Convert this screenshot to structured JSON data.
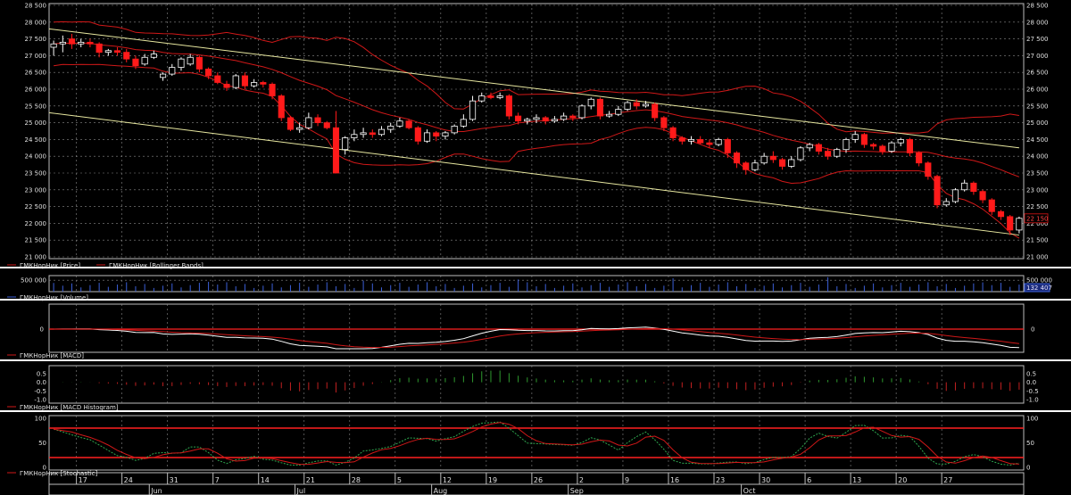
{
  "chart_data": [
    {
      "type": "candlestick",
      "panel": "price",
      "ylim": [
        21000,
        28500
      ],
      "ticks": [
        "21 000",
        "21 500",
        "22 000",
        "22 500",
        "23 000",
        "23 500",
        "24 000",
        "24 500",
        "25 000",
        "25 500",
        "26 000",
        "26 500",
        "27 000",
        "27 500",
        "28 000",
        "28 500"
      ],
      "tick_values": [
        21000,
        21500,
        22000,
        22500,
        23000,
        23500,
        24000,
        24500,
        25000,
        25500,
        26000,
        26500,
        27000,
        27500,
        28000,
        28500
      ],
      "last_price": "22 150",
      "last_value": 22150,
      "legend": [
        "ГМКНорНик [Price]",
        "ГМКНорНик [Bollinger Bands]"
      ],
      "candles": [
        {
          "o": 27250,
          "c": 27350,
          "h": 27450,
          "l": 27000
        },
        {
          "o": 27350,
          "c": 27400,
          "h": 27600,
          "l": 27100
        },
        {
          "o": 27500,
          "c": 27350,
          "h": 27650,
          "l": 27200
        },
        {
          "o": 27350,
          "c": 27400,
          "h": 27500,
          "l": 27250
        },
        {
          "o": 27400,
          "c": 27350,
          "h": 27500,
          "l": 27250
        },
        {
          "o": 27350,
          "c": 27100,
          "h": 27400,
          "l": 26950
        },
        {
          "o": 27100,
          "c": 27150,
          "h": 27200,
          "l": 27000
        },
        {
          "o": 27150,
          "c": 27100,
          "h": 27250,
          "l": 27000
        },
        {
          "o": 27100,
          "c": 26900,
          "h": 27200,
          "l": 26800
        },
        {
          "o": 26900,
          "c": 26700,
          "h": 27000,
          "l": 26600
        },
        {
          "o": 26750,
          "c": 26950,
          "h": 27050,
          "l": 26700
        },
        {
          "o": 26950,
          "c": 27050,
          "h": 27150,
          "l": 26900
        },
        {
          "o": 26350,
          "c": 26450,
          "h": 26500,
          "l": 26250
        },
        {
          "o": 26450,
          "c": 26650,
          "h": 26750,
          "l": 26400
        },
        {
          "o": 26650,
          "c": 26900,
          "h": 26950,
          "l": 26550
        },
        {
          "o": 26750,
          "c": 26950,
          "h": 27050,
          "l": 26700
        },
        {
          "o": 26950,
          "c": 26600,
          "h": 27000,
          "l": 26500
        },
        {
          "o": 26600,
          "c": 26400,
          "h": 26650,
          "l": 26300
        },
        {
          "o": 26400,
          "c": 26200,
          "h": 26500,
          "l": 26150
        },
        {
          "o": 26150,
          "c": 26050,
          "h": 26250,
          "l": 25950
        },
        {
          "o": 26050,
          "c": 26400,
          "h": 26450,
          "l": 26000
        },
        {
          "o": 26400,
          "c": 26100,
          "h": 26500,
          "l": 26000
        },
        {
          "o": 26100,
          "c": 26200,
          "h": 26300,
          "l": 26050
        },
        {
          "o": 26200,
          "c": 26150,
          "h": 26250,
          "l": 26050
        },
        {
          "o": 26150,
          "c": 25800,
          "h": 26200,
          "l": 25700
        },
        {
          "o": 25800,
          "c": 25150,
          "h": 25850,
          "l": 25050
        },
        {
          "o": 25150,
          "c": 24800,
          "h": 25200,
          "l": 24750
        },
        {
          "o": 24800,
          "c": 24850,
          "h": 25000,
          "l": 24700
        },
        {
          "o": 24850,
          "c": 25150,
          "h": 25300,
          "l": 24800
        },
        {
          "o": 25150,
          "c": 25000,
          "h": 25250,
          "l": 24900
        },
        {
          "o": 25000,
          "c": 24850,
          "h": 25050,
          "l": 24800
        },
        {
          "o": 24850,
          "c": 23500,
          "h": 25350,
          "l": 23700
        },
        {
          "o": 24200,
          "c": 24550,
          "h": 24600,
          "l": 24050
        },
        {
          "o": 24550,
          "c": 24650,
          "h": 24800,
          "l": 24450
        },
        {
          "o": 24650,
          "c": 24700,
          "h": 24850,
          "l": 24550
        },
        {
          "o": 24700,
          "c": 24650,
          "h": 24800,
          "l": 24550
        },
        {
          "o": 24650,
          "c": 24800,
          "h": 24900,
          "l": 24600
        },
        {
          "o": 24800,
          "c": 24900,
          "h": 25000,
          "l": 24700
        },
        {
          "o": 24900,
          "c": 25050,
          "h": 25150,
          "l": 24850
        },
        {
          "o": 25050,
          "c": 24850,
          "h": 25100,
          "l": 24800
        },
        {
          "o": 24850,
          "c": 24450,
          "h": 24900,
          "l": 24350
        },
        {
          "o": 24450,
          "c": 24700,
          "h": 24800,
          "l": 24400
        },
        {
          "o": 24700,
          "c": 24600,
          "h": 24750,
          "l": 24450
        },
        {
          "o": 24600,
          "c": 24700,
          "h": 24750,
          "l": 24500
        },
        {
          "o": 24700,
          "c": 24900,
          "h": 24950,
          "l": 24650
        },
        {
          "o": 24900,
          "c": 25100,
          "h": 25250,
          "l": 24850
        },
        {
          "o": 25100,
          "c": 25650,
          "h": 25800,
          "l": 25050
        },
        {
          "o": 25650,
          "c": 25800,
          "h": 25900,
          "l": 25600
        },
        {
          "o": 25800,
          "c": 25750,
          "h": 25900,
          "l": 25700
        },
        {
          "o": 25750,
          "c": 25800,
          "h": 25900,
          "l": 25700
        },
        {
          "o": 25800,
          "c": 25200,
          "h": 25850,
          "l": 25100
        },
        {
          "o": 25200,
          "c": 25050,
          "h": 25300,
          "l": 24950
        },
        {
          "o": 25050,
          "c": 25100,
          "h": 25150,
          "l": 24950
        },
        {
          "o": 25100,
          "c": 25150,
          "h": 25250,
          "l": 25000
        },
        {
          "o": 25150,
          "c": 25050,
          "h": 25200,
          "l": 24950
        },
        {
          "o": 25050,
          "c": 25100,
          "h": 25200,
          "l": 25000
        },
        {
          "o": 25100,
          "c": 25200,
          "h": 25300,
          "l": 25050
        },
        {
          "o": 25200,
          "c": 25150,
          "h": 25250,
          "l": 25050
        },
        {
          "o": 25150,
          "c": 25500,
          "h": 25550,
          "l": 25100
        },
        {
          "o": 25500,
          "c": 25700,
          "h": 25750,
          "l": 25400
        },
        {
          "o": 25700,
          "c": 25200,
          "h": 25750,
          "l": 25100
        },
        {
          "o": 25200,
          "c": 25250,
          "h": 25350,
          "l": 25150
        },
        {
          "o": 25250,
          "c": 25400,
          "h": 25500,
          "l": 25200
        },
        {
          "o": 25400,
          "c": 25600,
          "h": 25650,
          "l": 25350
        },
        {
          "o": 25600,
          "c": 25500,
          "h": 25700,
          "l": 25400
        },
        {
          "o": 25500,
          "c": 25550,
          "h": 25650,
          "l": 25450
        },
        {
          "o": 25550,
          "c": 25150,
          "h": 25600,
          "l": 25050
        },
        {
          "o": 25150,
          "c": 24850,
          "h": 25200,
          "l": 24750
        },
        {
          "o": 24850,
          "c": 24550,
          "h": 24900,
          "l": 24450
        },
        {
          "o": 24550,
          "c": 24450,
          "h": 24600,
          "l": 24350
        },
        {
          "o": 24450,
          "c": 24500,
          "h": 24600,
          "l": 24350
        },
        {
          "o": 24500,
          "c": 24400,
          "h": 24600,
          "l": 24350
        },
        {
          "o": 24400,
          "c": 24350,
          "h": 24500,
          "l": 24250
        },
        {
          "o": 24350,
          "c": 24500,
          "h": 24550,
          "l": 24300
        },
        {
          "o": 24500,
          "c": 24100,
          "h": 24550,
          "l": 23950
        },
        {
          "o": 24100,
          "c": 23800,
          "h": 24150,
          "l": 23650
        },
        {
          "o": 23800,
          "c": 23600,
          "h": 23850,
          "l": 23450
        },
        {
          "o": 23600,
          "c": 23800,
          "h": 23900,
          "l": 23550
        },
        {
          "o": 23800,
          "c": 24000,
          "h": 24100,
          "l": 23750
        },
        {
          "o": 24000,
          "c": 23900,
          "h": 24150,
          "l": 23800
        },
        {
          "o": 23900,
          "c": 23700,
          "h": 23950,
          "l": 23600
        },
        {
          "o": 23700,
          "c": 23900,
          "h": 24000,
          "l": 23650
        },
        {
          "o": 23900,
          "c": 24250,
          "h": 24300,
          "l": 23850
        },
        {
          "o": 24250,
          "c": 24350,
          "h": 24400,
          "l": 24150
        },
        {
          "o": 24350,
          "c": 24150,
          "h": 24400,
          "l": 24050
        },
        {
          "o": 24150,
          "c": 24000,
          "h": 24250,
          "l": 23900
        },
        {
          "o": 24000,
          "c": 24200,
          "h": 24250,
          "l": 23950
        },
        {
          "o": 24200,
          "c": 24500,
          "h": 24550,
          "l": 24100
        },
        {
          "o": 24500,
          "c": 24650,
          "h": 24750,
          "l": 24400
        },
        {
          "o": 24650,
          "c": 24350,
          "h": 24700,
          "l": 24250
        },
        {
          "o": 24350,
          "c": 24300,
          "h": 24400,
          "l": 24200
        },
        {
          "o": 24300,
          "c": 24150,
          "h": 24350,
          "l": 24050
        },
        {
          "o": 24150,
          "c": 24400,
          "h": 24450,
          "l": 24100
        },
        {
          "o": 24400,
          "c": 24500,
          "h": 24550,
          "l": 24300
        },
        {
          "o": 24500,
          "c": 24100,
          "h": 24550,
          "l": 24000
        },
        {
          "o": 24100,
          "c": 23800,
          "h": 24150,
          "l": 23700
        },
        {
          "o": 23800,
          "c": 23400,
          "h": 23850,
          "l": 23300
        },
        {
          "o": 23400,
          "c": 22550,
          "h": 23450,
          "l": 22450
        },
        {
          "o": 22550,
          "c": 22650,
          "h": 22750,
          "l": 22500
        },
        {
          "o": 22650,
          "c": 23000,
          "h": 23050,
          "l": 22600
        },
        {
          "o": 23000,
          "c": 23200,
          "h": 23300,
          "l": 22950
        },
        {
          "o": 23200,
          "c": 22950,
          "h": 23250,
          "l": 22850
        },
        {
          "o": 22950,
          "c": 22700,
          "h": 23000,
          "l": 22600
        },
        {
          "o": 22700,
          "c": 22350,
          "h": 22750,
          "l": 22250
        },
        {
          "o": 22350,
          "c": 22200,
          "h": 22400,
          "l": 22100
        },
        {
          "o": 22200,
          "c": 21800,
          "h": 22250,
          "l": 21650
        },
        {
          "o": 21800,
          "c": 22150,
          "h": 22200,
          "l": 21700
        }
      ],
      "trendlines": [
        {
          "x1": 0,
          "y1": 27800,
          "x2": 106,
          "y2": 24250
        },
        {
          "x1": 0,
          "y1": 25300,
          "x2": 106,
          "y2": 21650
        }
      ]
    },
    {
      "type": "bar",
      "panel": "volume",
      "tick_label": "500 000",
      "last_value_label": "132 407",
      "legend": [
        "ГМКНорНик [Volume]"
      ],
      "ylim": [
        0,
        700000
      ],
      "tick_values": [
        500000
      ]
    },
    {
      "type": "line",
      "panel": "macd",
      "tick_label": "0",
      "legend": [
        "ГМКНорНик [MACD]"
      ]
    },
    {
      "type": "bar",
      "panel": "macd_histogram",
      "ticks": [
        "0.5",
        "0.0",
        "-0.5",
        "-1.0"
      ],
      "tick_values": [
        0.5,
        0.0,
        -0.5,
        -1.0
      ],
      "legend": [
        "ГМКНорНик [MACD Histogram]"
      ]
    },
    {
      "type": "line",
      "panel": "stochastic",
      "ticks": [
        "100",
        "50",
        "0"
      ],
      "tick_values": [
        100,
        50,
        0
      ],
      "ylim": [
        0,
        100
      ],
      "levels": [
        80,
        20
      ],
      "legend": [
        "ГМКНорНик [Stochastic]"
      ]
    }
  ],
  "time_axis": {
    "day_labels": [
      "17",
      "24",
      "31",
      "7",
      "14",
      "21",
      "28",
      "5",
      "12",
      "19",
      "26",
      "2",
      "9",
      "16",
      "23",
      "30",
      "6",
      "13",
      "20",
      "27"
    ],
    "month_labels": [
      "Jun",
      "Jul",
      "Aug",
      "Sep",
      "Oct"
    ]
  },
  "colors": {
    "background": "#000000",
    "grid": "#8a8a8a",
    "candle_up": "#000000",
    "candle_up_outline": "#ffffff",
    "candle_down": "#ff1a1a",
    "bollinger": "#d01818",
    "trendline": "#e8e8a0",
    "panel_divider": "#ffffff",
    "volume": "#3b5fd8",
    "macd_line": "#ffffff",
    "signal_line": "#d01818",
    "hist_positive": "#2f9a2f",
    "hist_negative": "#c02020",
    "stoch_k": "#2fa84f",
    "stoch_d": "#d01818",
    "stoch_levels": "#ff2020",
    "last_price_box": "#b01010"
  }
}
